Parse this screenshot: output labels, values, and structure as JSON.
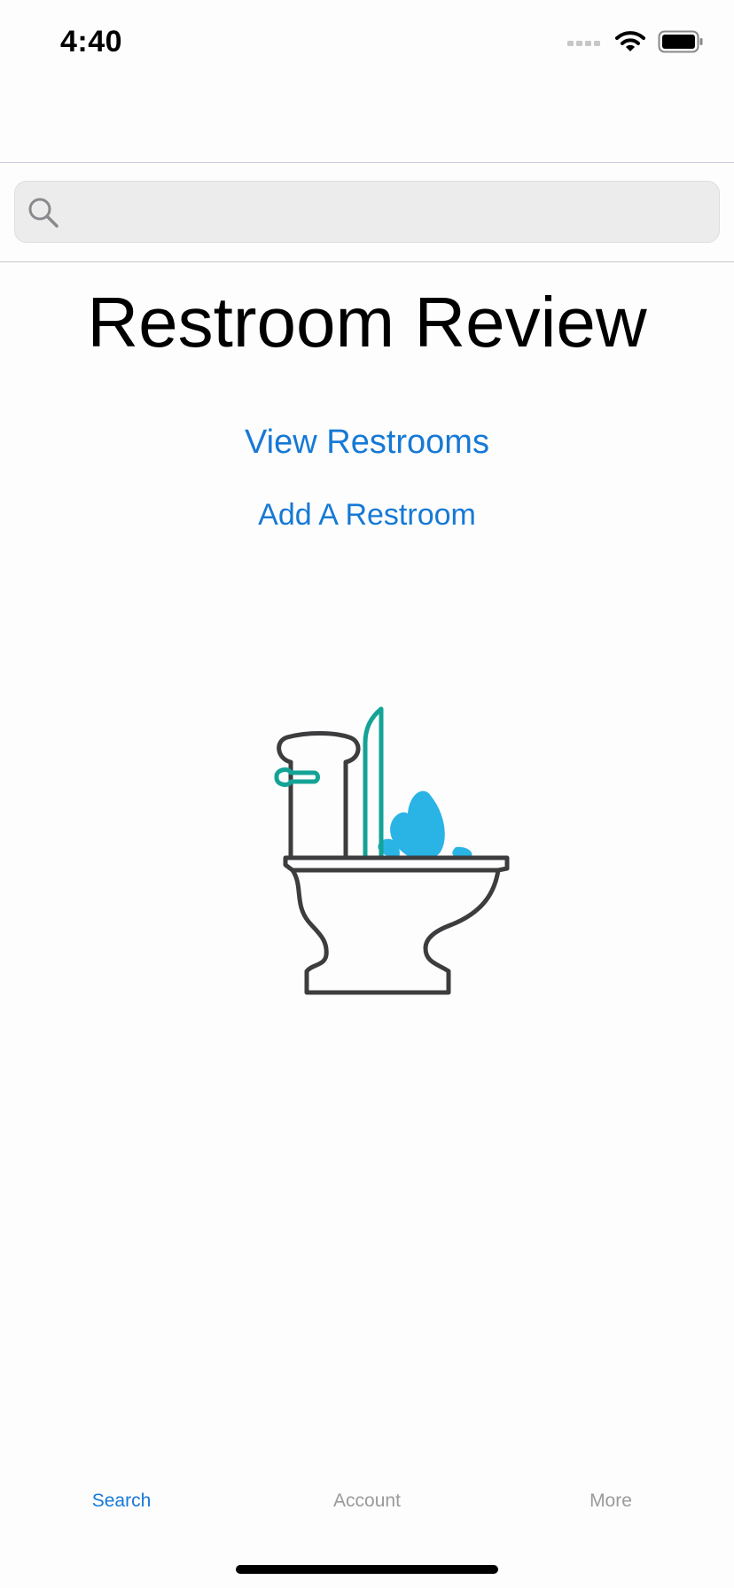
{
  "status_bar": {
    "time": "4:40",
    "icons": [
      "signal-icon",
      "wifi-icon",
      "battery-icon"
    ]
  },
  "search": {
    "placeholder": "",
    "value": ""
  },
  "main": {
    "title": "Restroom Review",
    "view_restrooms_label": "View Restrooms",
    "add_restroom_label": "Add A Restroom",
    "illustration": "toilet-illustration"
  },
  "tab_bar": {
    "tabs": [
      {
        "label": "Search",
        "selected": true
      },
      {
        "label": "Account",
        "selected": false
      },
      {
        "label": "More",
        "selected": false
      }
    ]
  },
  "colors": {
    "accent": "#1679d6",
    "tab_inactive": "#9a9a9a",
    "illustration_outline": "#3d3d3f",
    "illustration_teal": "#14a396",
    "illustration_water": "#2ab4e6"
  }
}
